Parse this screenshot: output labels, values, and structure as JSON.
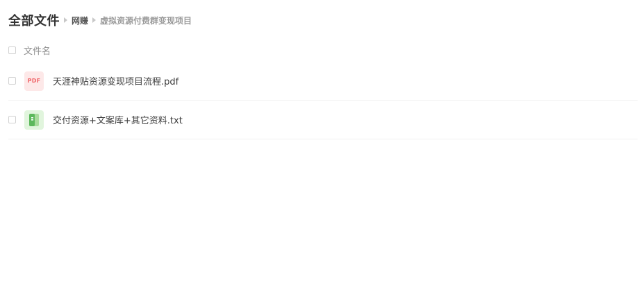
{
  "breadcrumb": {
    "root": "全部文件",
    "items": [
      "网赚",
      "虚拟资源付费群变现项目"
    ]
  },
  "list_header": {
    "name_column": "文件名"
  },
  "files": [
    {
      "name": "天涯神贴资源变现项目流程.pdf",
      "icon": "pdf-file-icon",
      "icon_text": "PDF",
      "icon_bg": "#fde8e8",
      "icon_color": "#f0666a"
    },
    {
      "name": "交付资源+文案库+其它资料.txt",
      "icon": "txt-file-icon",
      "icon_bg": "#e1f5dd",
      "icon_color": "#5cb85c"
    }
  ]
}
